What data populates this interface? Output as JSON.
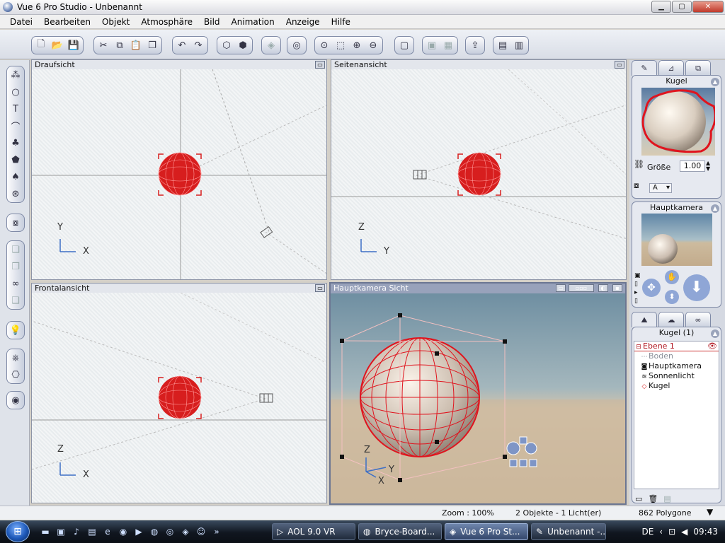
{
  "window": {
    "title": "Vue 6 Pro Studio - Unbenannt",
    "minimize": "▁",
    "maximize": "▢",
    "close": "✕"
  },
  "menu": [
    "Datei",
    "Bearbeiten",
    "Objekt",
    "Atmosphäre",
    "Bild",
    "Animation",
    "Anzeige",
    "Hilfe"
  ],
  "viewports": {
    "top": {
      "title": "Draufsicht",
      "axis_v": "Y",
      "axis_h": "X"
    },
    "side": {
      "title": "Seitenansicht",
      "axis_v": "Z",
      "axis_h": "Y"
    },
    "front": {
      "title": "Frontalansicht",
      "axis_v": "Z",
      "axis_h": "X"
    },
    "camera": {
      "title": "Hauptkamera Sicht",
      "axis_v": "Z",
      "axis_h": "Y",
      "axis_x": "X"
    }
  },
  "right_panel": {
    "object_name": "Kugel",
    "size_label": "Größe",
    "size_value": "1.00",
    "a_button": "A",
    "camera_name": "Hauptkamera",
    "layer_header": "Kugel (1)",
    "tree": [
      {
        "label": "Ebene 1",
        "icon": "layer-icon"
      },
      {
        "label": "Boden",
        "icon": "ground-icon"
      },
      {
        "label": "Hauptkamera",
        "icon": "camera-icon"
      },
      {
        "label": "Sonnenlicht",
        "icon": "sun-icon"
      },
      {
        "label": "Kugel",
        "icon": "sphere-icon"
      }
    ]
  },
  "status": {
    "zoom": "Zoom : 100%",
    "objects": "2 Objekte - 1 Licht(er)",
    "polygons": "862 Polygone"
  },
  "taskbar": {
    "tasks": [
      "AOL 9.0 VR",
      "Bryce-Board...",
      "Vue 6 Pro St...",
      "Unbenannt -..."
    ],
    "active_task": "Vue 6 Pro St...",
    "lang": "DE",
    "clock": "09:43"
  },
  "colors": {
    "selection_red": "#d71e1e",
    "accent": "#7f8aa6"
  }
}
